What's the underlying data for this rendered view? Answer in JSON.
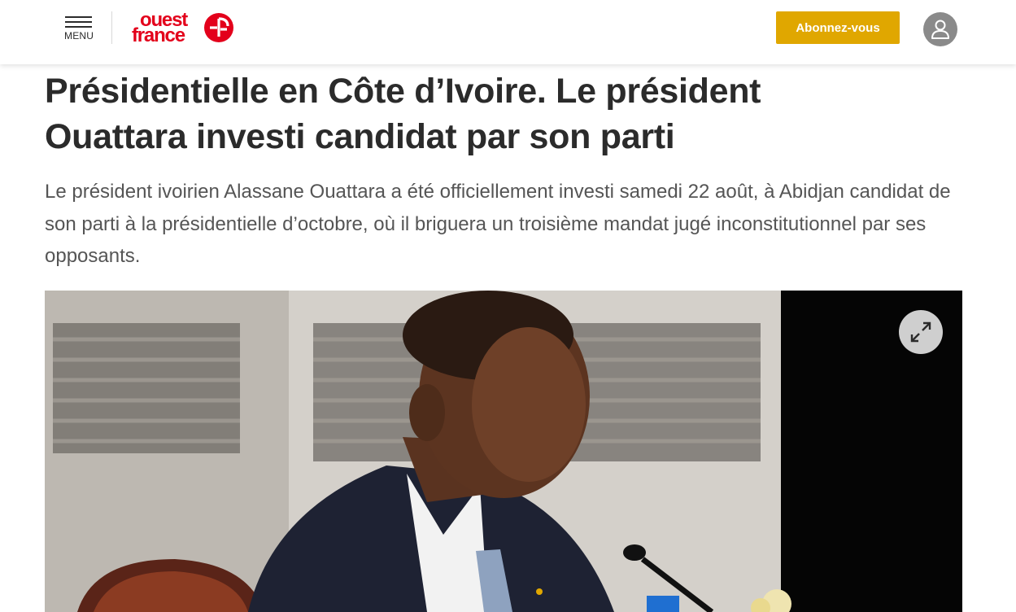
{
  "header": {
    "menu_label": "MENU",
    "logo": {
      "line1": "ouest",
      "line2": "france",
      "brand_color": "#e3001b"
    },
    "subscribe_label": "Abonnez-vous",
    "subscribe_color": "#e0a700",
    "account_icon": "user-icon"
  },
  "article": {
    "title": "Présidentielle en Côte d’Ivoire. Le président Ouattara investi candidat par son parti",
    "lead": "Le président ivoirien Alassane Ouattara a été officiellement investi samedi 22 août, à Abidjan candidat de son parti à la présidentielle d’octobre, où il briguera un troisième mandat jugé inconstitutionnel par ses opposants.",
    "photo": {
      "expand_icon": "expand-icon"
    }
  }
}
